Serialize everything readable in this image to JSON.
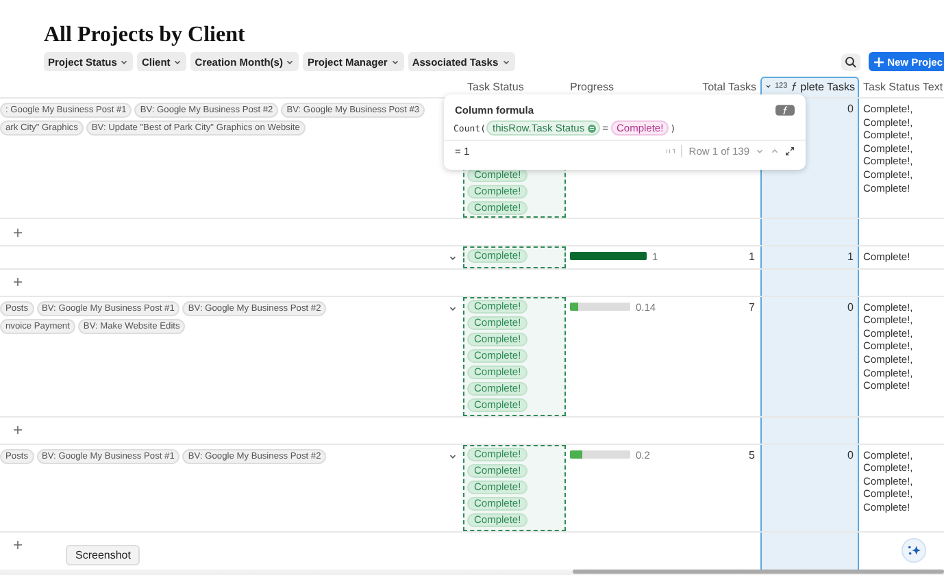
{
  "title": "All Projects by Client",
  "filters": [
    {
      "label": "Project Status"
    },
    {
      "label": "Client"
    },
    {
      "label": "Creation Month(s)"
    },
    {
      "label": "Project Manager"
    },
    {
      "label": "Associated Tasks"
    }
  ],
  "new_button": "New Projec",
  "columns": [
    {
      "label": "Task Status",
      "selected": false
    },
    {
      "label": "Progress",
      "selected": false
    },
    {
      "label": "Total Tasks",
      "selected": false
    },
    {
      "label": "plete Tasks",
      "selected": true,
      "type_badge": "123"
    },
    {
      "label": "Task Status Text",
      "selected": false
    }
  ],
  "rows": [
    {
      "tasks": [
        [
          ": Google My Business Post #1",
          "BV: Google My Business Post #2",
          "BV: Google My Business Post #3"
        ],
        [
          "ark City\" Graphics",
          "BV: Update \"Best of Park City\" Graphics on Website"
        ]
      ],
      "statuses": [
        "Complete!",
        "Complete!",
        "Complete!"
      ],
      "complete": "0",
      "status_text": [
        "Complete!,",
        "Complete!,",
        "Complete!,",
        "Complete!,",
        "Complete!,",
        "Complete!,",
        "Complete!"
      ]
    },
    {
      "tasks": [],
      "statuses": [
        "Complete!"
      ],
      "progress": {
        "level": 1,
        "reading": "1"
      },
      "total": "1",
      "complete": "1",
      "status_text": [
        "Complete!"
      ]
    },
    {
      "tasks": [
        [
          "Posts",
          "BV: Google My Business Post #1",
          "BV: Google My Business Post #2"
        ],
        [
          "nvoice Payment",
          "BV: Make Website Edits"
        ]
      ],
      "statuses": [
        "Complete!",
        "Complete!",
        "Complete!",
        "Complete!",
        "Complete!",
        "Complete!",
        "Complete!"
      ],
      "progress": {
        "level": 0.14,
        "reading": "0.14"
      },
      "total": "7",
      "complete": "0",
      "status_text": [
        "Complete!,",
        "Complete!,",
        "Complete!,",
        "Complete!,",
        "Complete!,",
        "Complete!,",
        "Complete!"
      ]
    },
    {
      "tasks": [
        [
          "Posts",
          "BV: Google My Business Post #1",
          "BV: Google My Business Post #2"
        ]
      ],
      "statuses": [
        "Complete!",
        "Complete!",
        "Complete!",
        "Complete!",
        "Complete!"
      ],
      "progress": {
        "level": 0.2,
        "reading": "0.2"
      },
      "total": "5",
      "complete": "0",
      "status_text": [
        "Complete!,",
        "Complete!,",
        "Complete!,",
        "Complete!,",
        "Complete!"
      ]
    }
  ],
  "formula": {
    "title": "Column formula",
    "function": "Count(",
    "reference": "thisRow.Task Status",
    "operator": "=",
    "value": "Complete!",
    "close": ")",
    "result": "= 1",
    "row_position": "Row 1 of 139"
  },
  "tooltip": "Screenshot"
}
